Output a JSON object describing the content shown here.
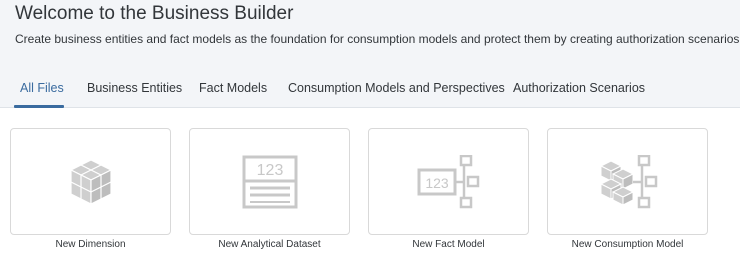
{
  "header": {
    "title": "Welcome to the Business Builder",
    "subtitle": "Create business entities and fact models as the foundation for consumption models and protect them by creating authorization scenarios"
  },
  "tabs": [
    {
      "label": "All Files",
      "active": true
    },
    {
      "label": "Business Entities",
      "active": false
    },
    {
      "label": "Fact Models",
      "active": false
    },
    {
      "label": "Consumption Models and Perspectives",
      "active": false
    },
    {
      "label": "Authorization Scenarios",
      "active": false
    }
  ],
  "tiles": [
    {
      "label": "New Dimension",
      "icon": "cube-icon"
    },
    {
      "label": "New Analytical Dataset",
      "icon": "dataset-table-icon",
      "icon_text": "123"
    },
    {
      "label": "New Fact Model",
      "icon": "fact-model-icon",
      "icon_text": "123"
    },
    {
      "label": "New Consumption Model",
      "icon": "consumption-model-icon"
    }
  ],
  "colors": {
    "accent": "#3a6b9f",
    "icon_gray": "#c8c8c8",
    "header_bg": "#f3f5f8"
  }
}
